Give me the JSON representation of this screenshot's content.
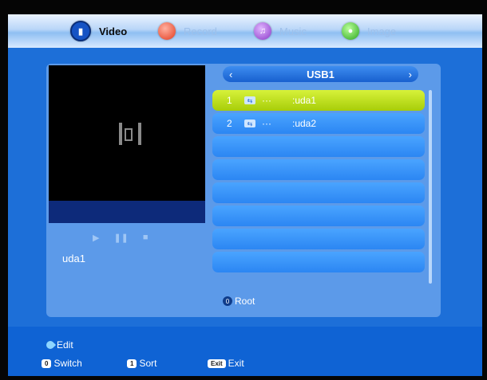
{
  "tabs": [
    {
      "label": "Video",
      "icon": "video-icon",
      "active": true
    },
    {
      "label": "Record",
      "icon": "record-icon",
      "active": false
    },
    {
      "label": "Music",
      "icon": "music-icon",
      "active": false
    },
    {
      "label": "Image",
      "icon": "image-icon",
      "active": false
    }
  ],
  "preview": {
    "icon": "film-icon",
    "controls": [
      "play-icon",
      "pause-icon",
      "stop-icon"
    ],
    "filename": "uda1"
  },
  "browser": {
    "device_title": "USB1",
    "prev_glyph": "‹",
    "next_glyph": "›",
    "rows": [
      {
        "num": "1",
        "icon": "usb-icon",
        "dots": "···",
        "name": ":uda1",
        "selected": true
      },
      {
        "num": "2",
        "icon": "usb-icon",
        "dots": "···",
        "name": ":uda2",
        "selected": false
      }
    ],
    "root_key": "0",
    "root_label": "Root"
  },
  "footer": {
    "edit_label": "Edit",
    "switch_key": "0",
    "switch_label": "Switch",
    "sort_key": "1",
    "sort_label": "Sort",
    "exit_key": "Exit",
    "exit_label": "Exit"
  },
  "colors": {
    "background": "#1d6fd8",
    "selected_row": "#c3e31f",
    "row": "#3a95fa"
  }
}
